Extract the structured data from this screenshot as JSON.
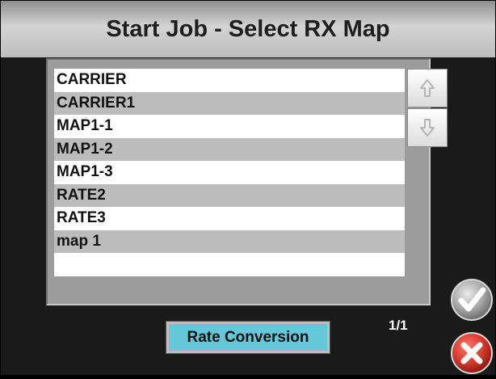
{
  "title": "Start Job - Select RX Map",
  "maps": [
    "CARRIER",
    "CARRIER1",
    "MAP1-1",
    "MAP1-2",
    "MAP1-3",
    "RATE2",
    "RATE3",
    "map 1",
    ""
  ],
  "page_indicator": "1/1",
  "rate_conversion_label": "Rate Conversion",
  "icons": {
    "scroll_up": "up-arrow-icon",
    "scroll_down": "down-arrow-icon",
    "accept": "checkmark-icon",
    "cancel": "close-icon"
  },
  "colors": {
    "accent_button": "#66c7d9",
    "cancel_red": "#c62828",
    "row_light": "#ffffff",
    "row_dark": "#bcbcbc"
  }
}
